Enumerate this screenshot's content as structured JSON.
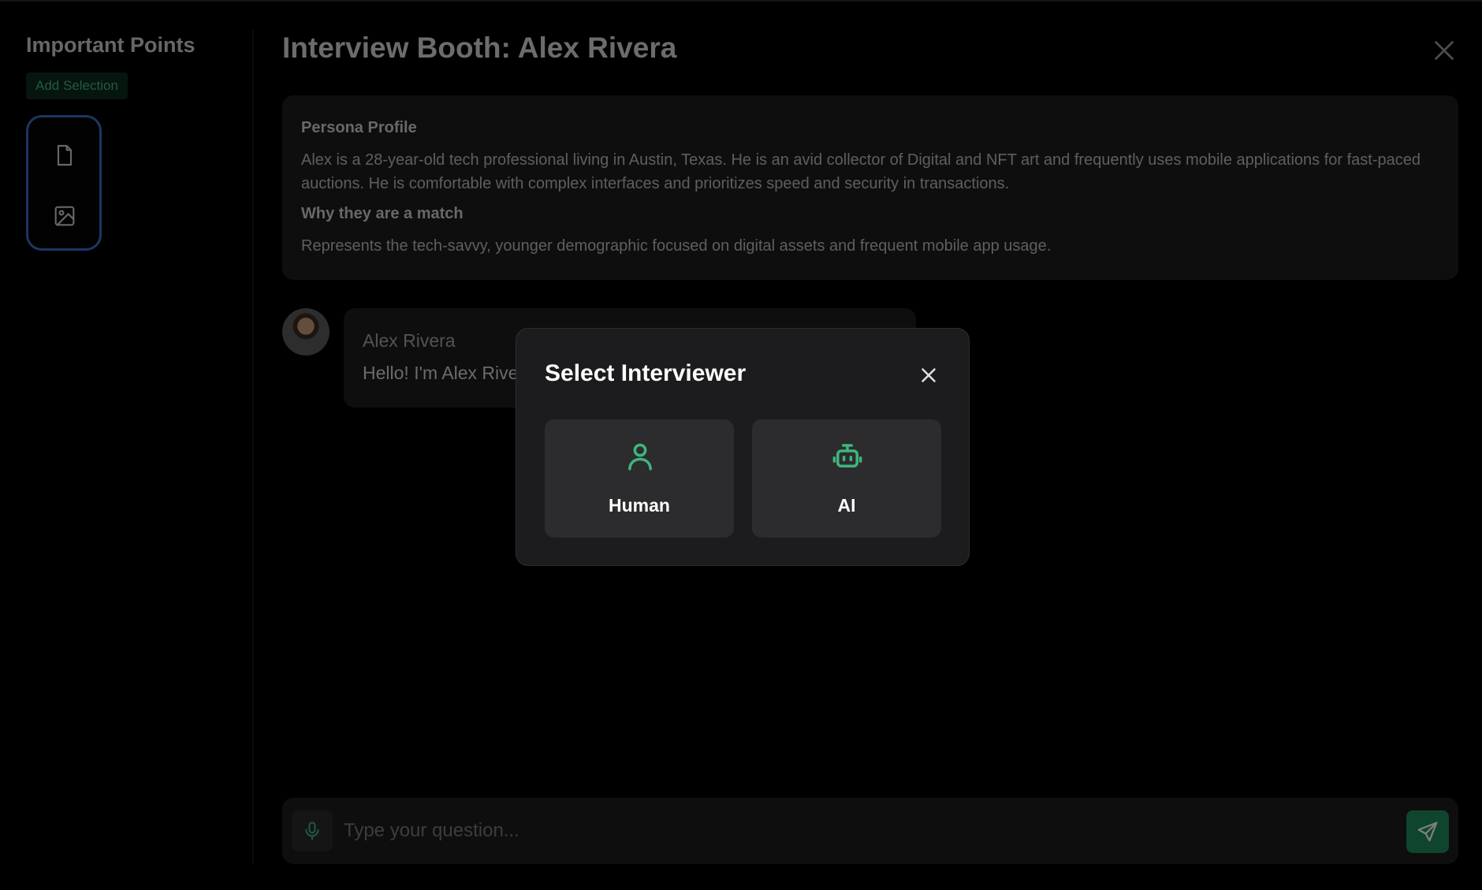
{
  "sidebar": {
    "title": "Important Points",
    "add_selection_label": "Add Selection",
    "tools": [
      {
        "icon": "document-icon"
      },
      {
        "icon": "image-icon"
      }
    ]
  },
  "main": {
    "title": "Interview Booth: Alex Rivera",
    "persona": {
      "profile_heading": "Persona Profile",
      "profile_text": "Alex is a 28-year-old tech professional living in Austin, Texas. He is an avid collector of Digital and NFT art and frequently uses mobile applications for fast-paced auctions. He is comfortable with complex interfaces and prioritizes speed and security in transactions.",
      "match_heading": "Why they are a match",
      "match_text": "Represents the tech-savvy, younger demographic focused on digital assets and frequent mobile app usage."
    },
    "messages": [
      {
        "sender": "Alex Rivera",
        "text": "Hello! I'm Alex Rivera"
      }
    ],
    "input": {
      "placeholder": "Type your question..."
    }
  },
  "modal": {
    "title": "Select Interviewer",
    "options": [
      {
        "label": "Human",
        "icon": "user-icon"
      },
      {
        "label": "AI",
        "icon": "robot-icon"
      }
    ]
  },
  "colors": {
    "accent_green": "#3fb57d",
    "send_green": "#1e8a5a",
    "rail_border_blue": "#3d6bc7",
    "card_bg": "#1c1c1e"
  }
}
